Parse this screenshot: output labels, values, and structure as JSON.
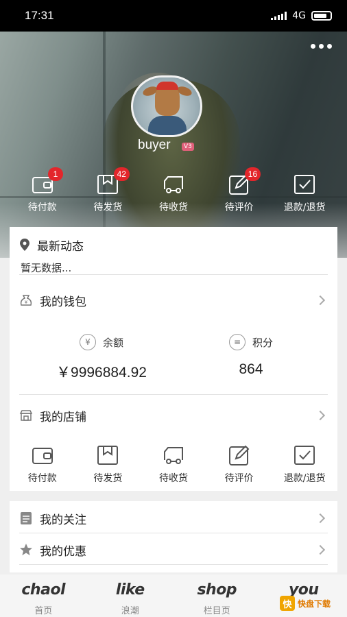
{
  "status_bar": {
    "time": "17:31",
    "network": "4G"
  },
  "profile": {
    "username": "buyer",
    "level": "V3"
  },
  "hero_orders": [
    {
      "label": "待付款",
      "badge": "1",
      "icon": "wallet-icon"
    },
    {
      "label": "待发货",
      "badge": "42",
      "icon": "package-icon"
    },
    {
      "label": "待收货",
      "badge": "",
      "icon": "truck-icon"
    },
    {
      "label": "待评价",
      "badge": "16",
      "icon": "edit-icon"
    },
    {
      "label": "退款/退货",
      "badge": "",
      "icon": "checkbox-icon"
    }
  ],
  "news": {
    "title": "最新动态",
    "empty_text": "暂无数据..."
  },
  "wallet": {
    "title": "我的钱包",
    "balance_label": "余额",
    "balance_value": "￥9996884.92",
    "points_label": "积分",
    "points_value": "864"
  },
  "store": {
    "title": "我的店铺",
    "orders": [
      {
        "label": "待付款",
        "icon": "wallet-icon"
      },
      {
        "label": "待发货",
        "icon": "package-icon"
      },
      {
        "label": "待收货",
        "icon": "truck-icon"
      },
      {
        "label": "待评价",
        "icon": "edit-icon"
      },
      {
        "label": "退款/退货",
        "icon": "checkbox-icon"
      }
    ]
  },
  "menu": {
    "follow": "我的关注",
    "coupons": "我的优惠"
  },
  "tabs": [
    {
      "logo": "chaol",
      "label": "首页"
    },
    {
      "logo": "like",
      "label": "浪潮"
    },
    {
      "logo": "shop",
      "label": "栏目页"
    },
    {
      "logo": "you",
      "label": ""
    }
  ],
  "watermark": {
    "text": "快盘下载"
  },
  "colors": {
    "badge": "#e3262b",
    "card": "#ffffff",
    "background": "#efefef"
  }
}
